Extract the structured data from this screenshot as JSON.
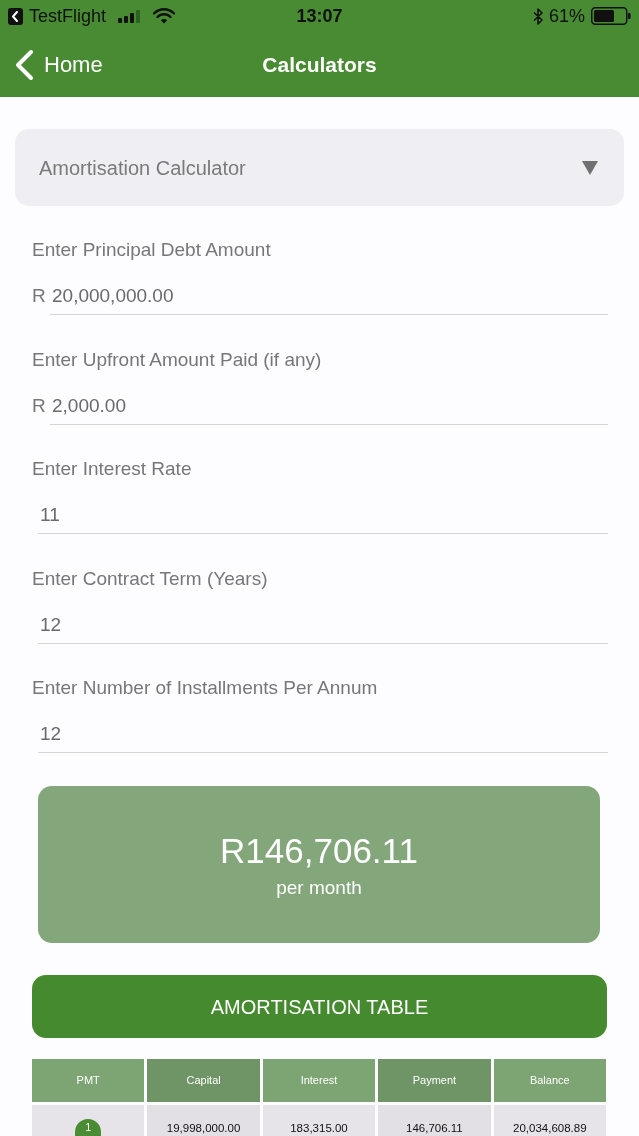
{
  "status_bar": {
    "app": "TestFlight",
    "time": "13:07",
    "battery": "61%"
  },
  "nav_bar": {
    "back": "Home",
    "title": "Calculators"
  },
  "calculator_select": {
    "value": "Amortisation Calculator"
  },
  "fields": [
    {
      "label": "Enter Principal Debt Amount",
      "prefix": "R",
      "value": "20,000,000.00"
    },
    {
      "label": "Enter Upfront Amount Paid (if any)",
      "prefix": "R",
      "value": "2,000.00"
    },
    {
      "label": "Enter Interest Rate",
      "value": "11"
    },
    {
      "label": "Enter Contract Term (Years)",
      "value": "12"
    },
    {
      "label": "Enter Number of Installments Per Annum",
      "value": "12"
    }
  ],
  "result": {
    "amount": "R146,706.11",
    "caption": "per month"
  },
  "table_button": {
    "label": "AMORTISATION TABLE"
  },
  "table": {
    "columns": [
      "PMT",
      "Capital",
      "Interest",
      "Payment",
      "Balance"
    ],
    "rows": [
      [
        "1",
        "19,998,000.00",
        "183,315.00",
        "146,706.11",
        "20,034,608.89"
      ]
    ]
  }
}
